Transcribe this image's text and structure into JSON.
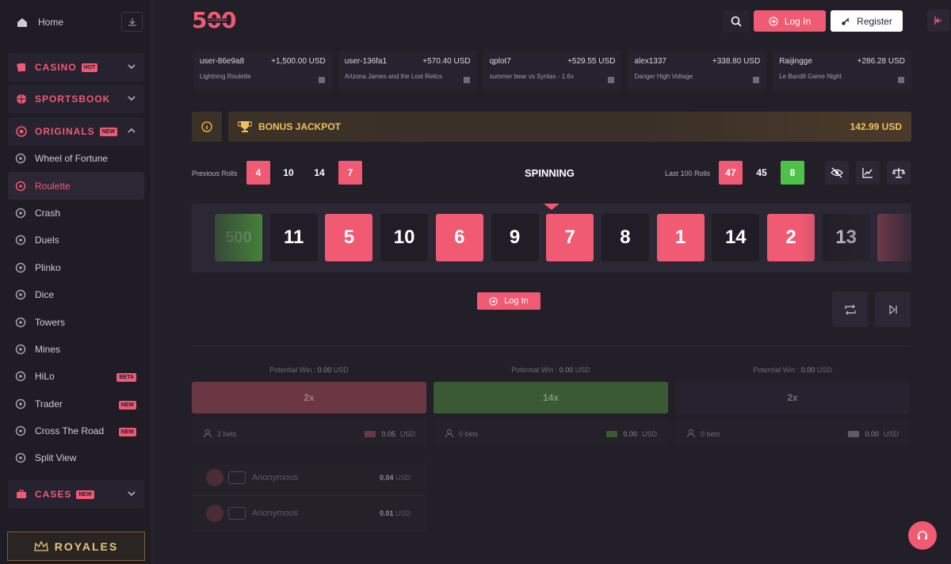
{
  "sidebar": {
    "home_label": "Home",
    "casino_label": "CASINO",
    "casino_badge": "HOT",
    "sportsbook_label": "SPORTSBOOK",
    "originals_label": "ORIGINALS",
    "originals_badge": "NEW",
    "originals": [
      {
        "label": "Wheel of Fortune",
        "icon": "wheel-icon"
      },
      {
        "label": "Roulette",
        "icon": "roulette-icon",
        "active": true
      },
      {
        "label": "Crash",
        "icon": "rocket-icon"
      },
      {
        "label": "Duels",
        "icon": "duels-icon"
      },
      {
        "label": "Plinko",
        "icon": "plinko-icon"
      },
      {
        "label": "Dice",
        "icon": "dice-icon"
      },
      {
        "label": "Towers",
        "icon": "diamond-icon"
      },
      {
        "label": "Mines",
        "icon": "bomb-icon"
      },
      {
        "label": "HiLo",
        "icon": "updown-icon",
        "badge": "BETA"
      },
      {
        "label": "Trader",
        "icon": "candles-icon",
        "badge": "NEW"
      },
      {
        "label": "Cross The Road",
        "icon": "road-icon",
        "badge": "NEW"
      },
      {
        "label": "Split View",
        "icon": "split-icon"
      }
    ],
    "cases_label": "CASES",
    "cases_badge": "NEW",
    "royales_label": "ROYALES"
  },
  "header": {
    "logo_text": "500",
    "logo_sub": "CASINO",
    "login_label": "Log In",
    "register_label": "Register"
  },
  "feed": [
    {
      "user": "user-86e9a8",
      "amount": "+1,500.00 USD",
      "game": "Lightning Roulette"
    },
    {
      "user": "user-136fa1",
      "amount": "+570.40 USD",
      "game": "Arizona James and the Lost Relics"
    },
    {
      "user": "qplot7",
      "amount": "+529.55 USD",
      "game": "summer bear vs Syntax - 1.6x"
    },
    {
      "user": "alex1337",
      "amount": "+338.80 USD",
      "game": "Danger High Voltage"
    },
    {
      "user": "Raijingge",
      "amount": "+286.28 USD",
      "game": "Le Bandit Game Night"
    }
  ],
  "jackpot": {
    "label": "BONUS JACKPOT",
    "value": "142.99 USD"
  },
  "rolls": {
    "previous_label": "Previous Rolls",
    "previous": [
      {
        "v": "4",
        "c": "red"
      },
      {
        "v": "10",
        "c": "blk"
      },
      {
        "v": "14",
        "c": "blk"
      },
      {
        "v": "7",
        "c": "red"
      }
    ],
    "status": "SPINNING",
    "last100_label": "Last 100 Rolls",
    "last100": [
      {
        "v": "47",
        "c": "red"
      },
      {
        "v": "45",
        "c": "blk"
      },
      {
        "v": "8",
        "c": "grn"
      }
    ]
  },
  "reel": [
    {
      "v": "500",
      "c": "grn"
    },
    {
      "v": "11",
      "c": "blk"
    },
    {
      "v": "5",
      "c": "red"
    },
    {
      "v": "10",
      "c": "blk"
    },
    {
      "v": "6",
      "c": "red"
    },
    {
      "v": "9",
      "c": "blk"
    },
    {
      "v": "7",
      "c": "red"
    },
    {
      "v": "8",
      "c": "blk"
    },
    {
      "v": "1",
      "c": "red"
    },
    {
      "v": "14",
      "c": "blk"
    },
    {
      "v": "2",
      "c": "red"
    },
    {
      "v": "13",
      "c": "blk"
    },
    {
      "v": "",
      "c": "red"
    }
  ],
  "center_login_label": "Log In",
  "columns": [
    {
      "pw_label": "Potential Win :",
      "pw_value": "0.00",
      "pw_unit": "USD",
      "mult": "2x",
      "color": "red",
      "bets": "2 bets",
      "total": "0.05",
      "unit": "USD"
    },
    {
      "pw_label": "Potential Win :",
      "pw_value": "0.00",
      "pw_unit": "USD",
      "mult": "14x",
      "color": "grn",
      "bets": "0 bets",
      "total": "0.00",
      "unit": "USD"
    },
    {
      "pw_label": "Potential Win :",
      "pw_value": "0.00",
      "pw_unit": "USD",
      "mult": "2x",
      "color": "blk",
      "bets": "0 bets",
      "total": "0.00",
      "unit": "USD"
    }
  ],
  "players": [
    {
      "name": "Anonymous",
      "amount": "0.04",
      "unit": "USD"
    },
    {
      "name": "Anonymous",
      "amount": "0.01",
      "unit": "USD"
    }
  ],
  "colors": {
    "accent": "#f05a73",
    "green": "#4ec14b",
    "gold": "#f0c15a"
  }
}
